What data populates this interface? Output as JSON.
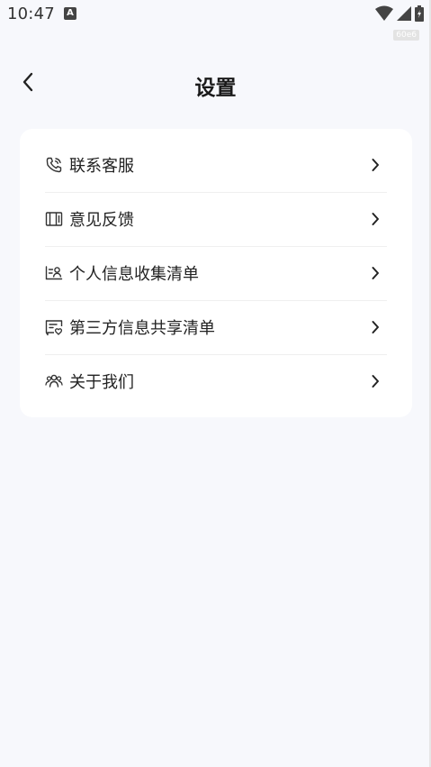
{
  "status_bar": {
    "time": "10:47",
    "notification_glyph": "A",
    "icons": [
      "wifi-icon",
      "signal-icon",
      "battery-icon"
    ]
  },
  "debug_badge": "60e6",
  "header": {
    "title": "设置",
    "back_icon": "chevron-left-icon"
  },
  "menu": {
    "items": [
      {
        "label": "联系客服",
        "icon": "phone-icon"
      },
      {
        "label": "意见反馈",
        "icon": "feedback-icon"
      },
      {
        "label": "个人信息收集清单",
        "icon": "personal-info-icon"
      },
      {
        "label": "第三方信息共享清单",
        "icon": "third-party-share-icon"
      },
      {
        "label": "关于我们",
        "icon": "people-icon"
      }
    ]
  },
  "colors": {
    "background": "#f7f8fc",
    "card": "#ffffff",
    "text": "#222222",
    "divider": "#efefef"
  }
}
